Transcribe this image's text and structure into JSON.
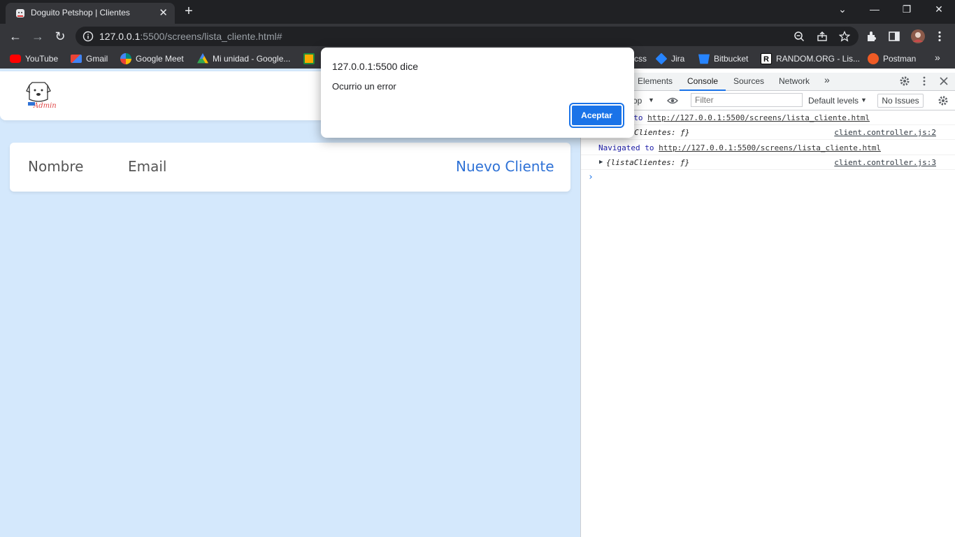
{
  "browser": {
    "tab_title": "Doguito Petshop | Clientes",
    "tab_close": "✕",
    "new_tab": "+",
    "url_host": "127.0.0.1",
    "url_rest": ":5500/screens/lista_cliente.html#",
    "window_controls": {
      "minimize": "—",
      "restore": "❐",
      "close": "✕",
      "tab_search": "⌄"
    },
    "nav": {
      "back": "←",
      "forward": "→",
      "reload": "↻"
    }
  },
  "bookmarks": [
    {
      "label": "YouTube",
      "icon": "youtube-icon",
      "color": "#ff0000"
    },
    {
      "label": "Gmail",
      "icon": "gmail-icon",
      "color": "#ea4335"
    },
    {
      "label": "Google Meet",
      "icon": "meet-icon",
      "color": "#00897b"
    },
    {
      "label": "Mi unidad - Google...",
      "icon": "drive-icon",
      "color": "#fbbc04"
    },
    {
      "label": "",
      "icon": "classroom-icon",
      "color": "#f9ab00"
    },
    {
      "label": "css",
      "icon": "css-icon",
      "color": "#35363a"
    },
    {
      "label": "Jira",
      "icon": "jira-icon",
      "color": "#2684ff"
    },
    {
      "label": "Bitbucket",
      "icon": "bitbucket-icon",
      "color": "#2684ff"
    },
    {
      "label": "RANDOM.ORG - Lis...",
      "icon": "random-org-icon",
      "color": "#ffffff"
    },
    {
      "label": "Postman",
      "icon": "postman-icon",
      "color": "#ef5b25"
    }
  ],
  "bookmarks_more": "»",
  "page": {
    "logo_text": "Admin",
    "table": {
      "col_name": "Nombre",
      "col_email": "Email",
      "new_client": "Nuevo Cliente"
    }
  },
  "devtools": {
    "tabs": [
      "Elements",
      "Console",
      "Sources",
      "Network"
    ],
    "active_tab": "Console",
    "more_tabs": "»",
    "context": "op",
    "filter_placeholder": "Filter",
    "levels": "Default levels",
    "issues": "No Issues",
    "logs": [
      {
        "kind": "nav",
        "prefix": "d to",
        "url": "http://127.0.0.1:5500/screens/lista_cliente.html"
      },
      {
        "kind": "obj",
        "text": "Clientes: ƒ}",
        "source": "client.controller.js:2"
      },
      {
        "kind": "nav",
        "prefix": "Navigated to",
        "url": "http://127.0.0.1:5500/screens/lista_cliente.html"
      },
      {
        "kind": "obj",
        "text": "{listaClientes: ƒ}",
        "source": "client.controller.js:3"
      }
    ],
    "prompt": "›"
  },
  "alert": {
    "title": "127.0.0.1:5500 dice",
    "message": "Ocurrio un error",
    "ok": "Aceptar"
  }
}
